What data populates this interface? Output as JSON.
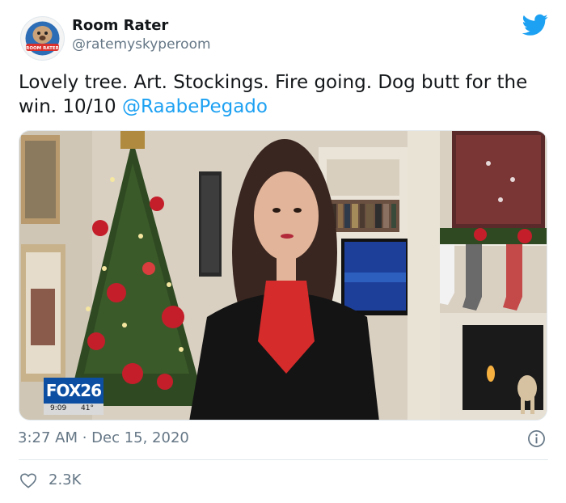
{
  "tweet": {
    "author_name": "Room Rater",
    "author_handle": "@ratemyskyperoom",
    "avatar_text": "ROOM RATER",
    "text_main": "Lovely tree. Art. Stockings. Fire going. Dog butt for the win. 10/10 ",
    "mention": "@RaabePegado",
    "timestamp": "3:27 AM · Dec 15, 2020",
    "likes": "2.3K"
  },
  "media": {
    "station_logo": "FOX26",
    "station_time": "9:09",
    "station_temp": "41°"
  },
  "icons": {
    "brand": "twitter-bird-icon",
    "info": "info-icon",
    "like": "heart-icon"
  },
  "colors": {
    "accent": "#1da1f2",
    "secondary_text": "#657786",
    "divider": "#e1e8ed"
  }
}
